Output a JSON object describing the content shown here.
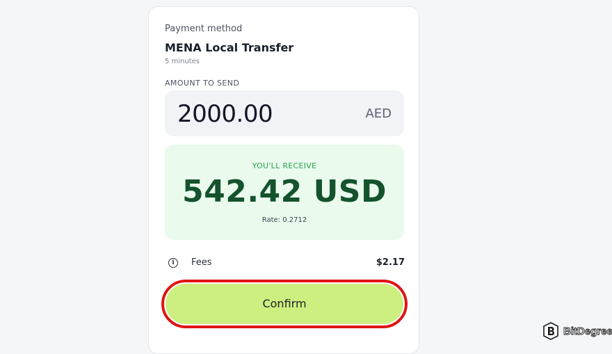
{
  "payment": {
    "method_label": "Payment method",
    "method_name": "MENA Local Transfer",
    "eta": "5 minutes"
  },
  "send": {
    "label": "AMOUNT TO SEND",
    "amount": "2000.00",
    "currency": "AED"
  },
  "receive": {
    "label": "YOU'LL RECEIVE",
    "amount": "542.42 USD",
    "rate": "Rate: 0.2712"
  },
  "fees": {
    "icon": "info-icon",
    "label": "Fees",
    "value": "$2.17"
  },
  "actions": {
    "confirm_label": "Confirm"
  },
  "watermark": {
    "text": "BitDegree",
    "logo": "bitdegree-logo"
  },
  "colors": {
    "receive_bg": "#eafbee",
    "receive_accent": "#29a34a",
    "receive_amount": "#14532d",
    "confirm_bg": "#cdef7f",
    "highlight_outline": "#e01414"
  }
}
